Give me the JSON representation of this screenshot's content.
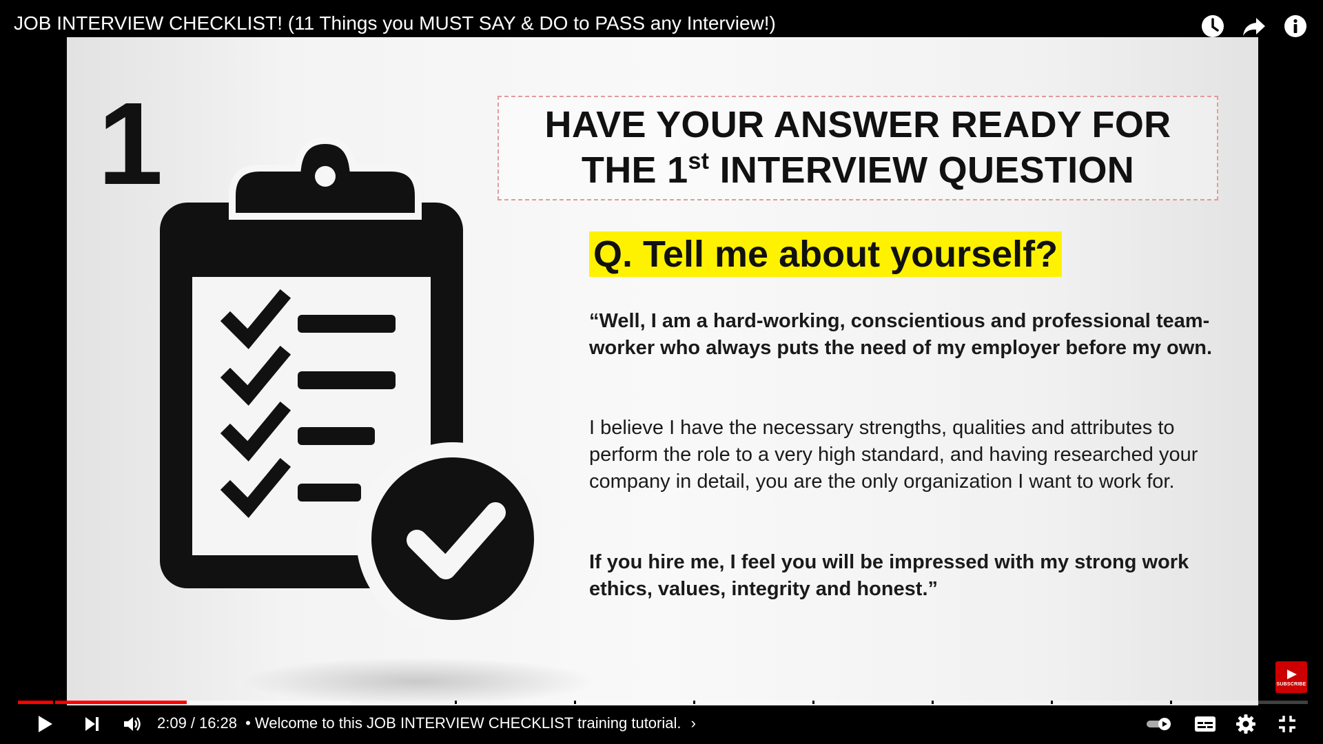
{
  "video": {
    "title": "JOB INTERVIEW CHECKLIST! (11 Things you MUST SAY & DO to PASS any Interview!)"
  },
  "slide": {
    "step_number": "1",
    "headline_line1": "HAVE YOUR ANSWER READY FOR",
    "headline_line2_prefix": "THE 1",
    "headline_line2_sup": "st",
    "headline_line2_suffix": " INTERVIEW QUESTION",
    "question": "Q. Tell me about yourself?",
    "answer_para1": "“Well, I am a hard-working, conscientious and professional team-worker who always puts the need of my employer before my own.",
    "answer_para2": "I believe I have the necessary strengths, qualities and attributes to perform the role to a very high standard, and having researched your company in detail, you are the only organization I want to work for.",
    "answer_para3": "If you hire me, I feel you will be impressed with my strong work ethics, values, integrity and honest.”"
  },
  "watermark": {
    "label": "SUBSCRIBE"
  },
  "player": {
    "current_time": "2:09",
    "duration": "16:28",
    "time_separator": "/",
    "chapter_bullet": "•",
    "chapter_title": "Welcome to this JOB INTERVIEW CHECKLIST training tutorial.",
    "chapter_chevron": "›",
    "played_fraction": 0.131,
    "buffered_fraction": 0.258,
    "accent_color": "#ff0000"
  },
  "icons": {
    "watch_later": "clock-icon",
    "share": "share-icon",
    "info": "info-icon",
    "play": "play-icon",
    "next": "next-icon",
    "volume": "volume-icon",
    "autoplay": "autoplay-toggle-icon",
    "captions": "subtitles-icon",
    "settings": "gear-icon",
    "exit_fullscreen": "exit-fullscreen-icon"
  }
}
